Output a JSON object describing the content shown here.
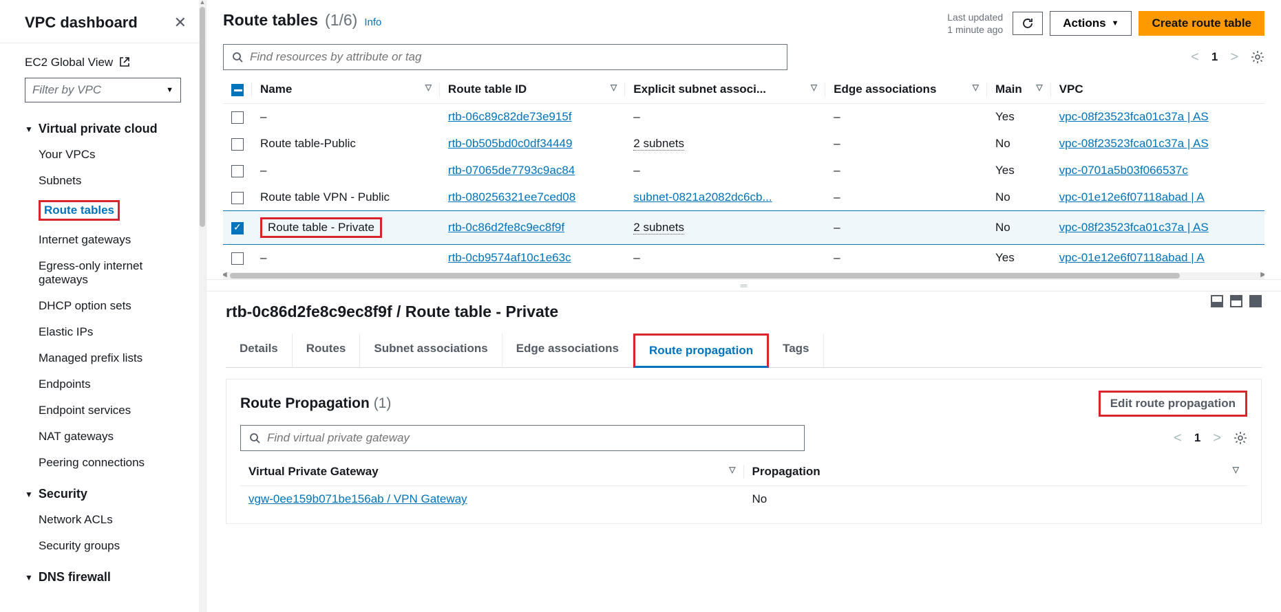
{
  "sidebar": {
    "title": "VPC dashboard",
    "ec2_global": "EC2 Global View",
    "filter_placeholder": "Filter by VPC",
    "sections": {
      "vpc": {
        "title": "Virtual private cloud",
        "items": [
          "Your VPCs",
          "Subnets",
          "Route tables",
          "Internet gateways",
          "Egress-only internet gateways",
          "DHCP option sets",
          "Elastic IPs",
          "Managed prefix lists",
          "Endpoints",
          "Endpoint services",
          "NAT gateways",
          "Peering connections"
        ]
      },
      "security": {
        "title": "Security",
        "items": [
          "Network ACLs",
          "Security groups"
        ]
      },
      "dns": {
        "title": "DNS firewall"
      }
    }
  },
  "header": {
    "title": "Route tables",
    "count": "(1/6)",
    "info": "Info",
    "last_updated_l1": "Last updated",
    "last_updated_l2": "1 minute ago",
    "actions": "Actions",
    "create": "Create route table"
  },
  "search": {
    "placeholder": "Find resources by attribute or tag"
  },
  "pager": {
    "page": "1"
  },
  "columns": [
    "Name",
    "Route table ID",
    "Explicit subnet associ...",
    "Edge associations",
    "Main",
    "VPC"
  ],
  "rows": [
    {
      "checked": false,
      "name": "–",
      "rtb": "rtb-06c89c82de73e915f",
      "subnet": "–",
      "subnet_link": false,
      "edge": "–",
      "main": "Yes",
      "vpc": "vpc-08f23523fca01c37a | AS"
    },
    {
      "checked": false,
      "name": "Route table-Public",
      "rtb": "rtb-0b505bd0c0df34449",
      "subnet": "2 subnets",
      "subnet_link": false,
      "subnet_dotted": true,
      "edge": "–",
      "main": "No",
      "vpc": "vpc-08f23523fca01c37a | AS"
    },
    {
      "checked": false,
      "name": "–",
      "rtb": "rtb-07065de7793c9ac84",
      "subnet": "–",
      "subnet_link": false,
      "edge": "–",
      "main": "Yes",
      "vpc": "vpc-0701a5b03f066537c"
    },
    {
      "checked": false,
      "name": "Route table VPN - Public",
      "rtb": "rtb-080256321ee7ced08",
      "subnet": "subnet-0821a2082dc6cb...",
      "subnet_link": true,
      "edge": "–",
      "main": "No",
      "vpc": "vpc-01e12e6f07118abad | A"
    },
    {
      "checked": true,
      "name": "Route table - Private",
      "rtb": "rtb-0c86d2fe8c9ec8f9f",
      "subnet": "2 subnets",
      "subnet_link": false,
      "subnet_dotted": true,
      "edge": "–",
      "main": "No",
      "vpc": "vpc-08f23523fca01c37a | AS",
      "redbox": true
    },
    {
      "checked": false,
      "name": "–",
      "rtb": "rtb-0cb9574af10c1e63c",
      "subnet": "–",
      "subnet_link": false,
      "edge": "–",
      "main": "Yes",
      "vpc": "vpc-01e12e6f07118abad | A"
    }
  ],
  "details": {
    "title": "rtb-0c86d2fe8c9ec8f9f / Route table - Private",
    "tabs": [
      "Details",
      "Routes",
      "Subnet associations",
      "Edge associations",
      "Route propagation",
      "Tags"
    ],
    "panel_title": "Route Propagation",
    "panel_count": "(1)",
    "edit": "Edit route propagation",
    "search_placeholder": "Find virtual private gateway",
    "col1": "Virtual Private Gateway",
    "col2": "Propagation",
    "vgw": "vgw-0ee159b071be156ab / VPN Gateway",
    "prop": "No",
    "page": "1"
  }
}
